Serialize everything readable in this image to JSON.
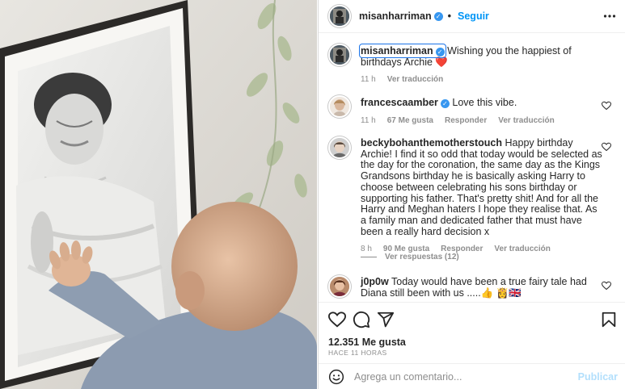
{
  "post": {
    "image_alt": "Baby touching a framed black-and-white photo of Princess Diana",
    "author": "misanharriman",
    "verified": true,
    "follow_label": "Seguir",
    "dot": "•"
  },
  "caption": {
    "author": "misanharriman",
    "text": "Wishing you the happiest of birthdays Archie ❤️",
    "time": "11 h",
    "translate": "Ver traducción"
  },
  "comments": [
    {
      "author": "francescaamber",
      "verified": true,
      "text": "Love this vibe.",
      "time": "11 h",
      "likes": "67 Me gusta",
      "reply": "Responder",
      "translate": "Ver traducción"
    },
    {
      "author": "beckybohanthemotherstouch",
      "verified": false,
      "text": "Happy birthday Archie! I find it so odd that today would be selected as the day for the coronation, the same day as the Kings Grandsons birthday he is basically asking Harry to choose between celebrating his sons birthday or supporting his father. That's pretty shit! And for all the Harry and Meghan haters I hope they realise that. As a family man and dedicated father that must have been a really hard decision x",
      "time": "8 h",
      "likes": "90 Me gusta",
      "reply": "Responder",
      "translate": "Ver traducción",
      "view_replies": "Ver respuestas (12)"
    },
    {
      "author": "j0p0w",
      "verified": false,
      "text": "Today would have been a true fairy tale had Diana still been with us .....👍 👸🇬🇧"
    }
  ],
  "stats": {
    "likes": "12.351 Me gusta",
    "ago": "HACE 11 HORAS"
  },
  "add_comment": {
    "placeholder": "Agrega un comentario...",
    "post_label": "Publicar"
  },
  "colors": {
    "link_blue": "#0095f6",
    "verified_blue": "#3897f0",
    "muted": "#8e8e8e",
    "heart_red": "#ed4956"
  },
  "icons": [
    "more-options-icon",
    "heart-icon",
    "comment-icon",
    "share-icon",
    "bookmark-icon",
    "emoji-icon",
    "verified-icon"
  ]
}
